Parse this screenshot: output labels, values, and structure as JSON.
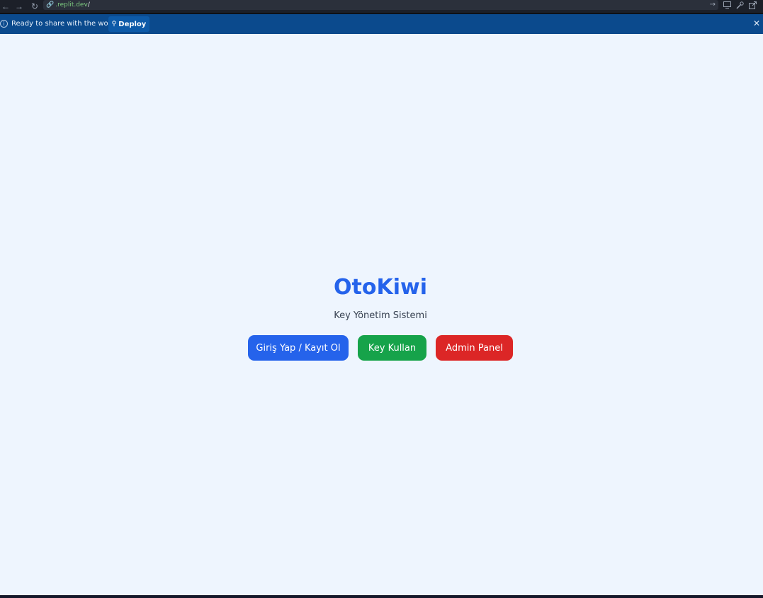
{
  "browser": {
    "url_host": ".replit.dev",
    "url_path": "/",
    "icons": {
      "back": "arrow-left-icon",
      "forward": "arrow-right-icon",
      "reload": "reload-icon",
      "link": "link-icon",
      "go": "arrow-right-icon",
      "devices": "monitor-icon",
      "tools": "wrench-icon",
      "open_external": "external-link-icon"
    }
  },
  "banner": {
    "text": "Ready to share with the world?",
    "deploy_label": "Deploy",
    "background_color": "#0b4a8d"
  },
  "app": {
    "title": "OtoKiwi",
    "subtitle": "Key Yönetim Sistemi",
    "buttons": {
      "login_label": "Giriş Yap / Kayıt Ol",
      "key_label": "Key Kullan",
      "admin_label": "Admin Panel"
    },
    "colors": {
      "title": "#2563eb",
      "login": "#2563eb",
      "key": "#16a34a",
      "admin": "#dc2626",
      "background": "#eef5fe"
    }
  }
}
